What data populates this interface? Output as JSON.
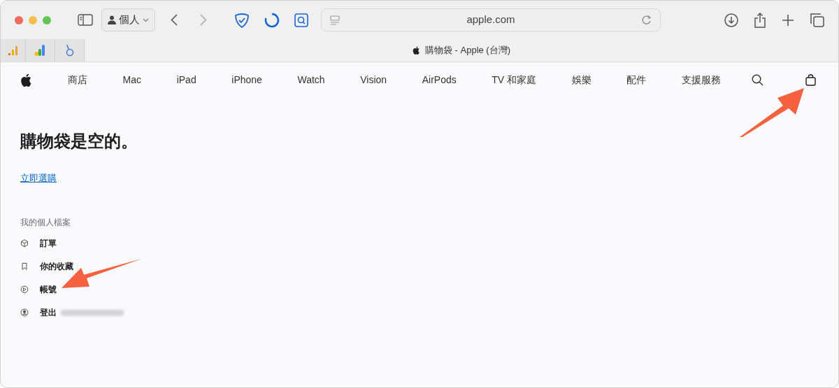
{
  "browser": {
    "profile": "個人",
    "address": "apple.com",
    "tab_title": "購物袋 - Apple (台灣)"
  },
  "nav": {
    "items": [
      "商店",
      "Mac",
      "iPad",
      "iPhone",
      "Watch",
      "Vision",
      "AirPods",
      "TV 和家庭",
      "娛樂",
      "配件",
      "支援服務"
    ]
  },
  "page": {
    "heading": "購物袋是空的。",
    "link": "立即選購",
    "section_title": "我的個人檔案",
    "items": [
      {
        "label": "訂單"
      },
      {
        "label": "你的收藏"
      },
      {
        "label": "帳號"
      },
      {
        "label": "登出",
        "blurred_name": true
      }
    ]
  }
}
